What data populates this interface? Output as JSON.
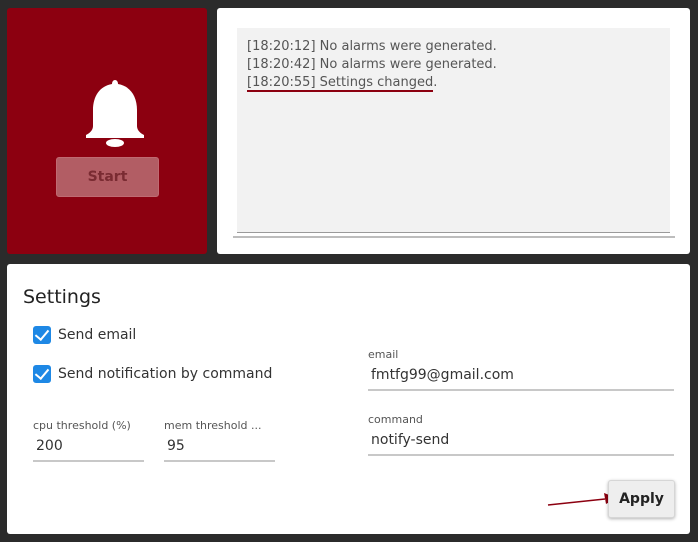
{
  "alarm": {
    "start_label": "Start",
    "bell_icon": "bell-icon",
    "panel_color": "#8c0010"
  },
  "log": {
    "lines": [
      "[18:20:12] No alarms were generated.",
      "[18:20:42] No alarms were generated."
    ],
    "last_line_highlighted": "[18:20:55] Settings changed",
    "last_line_suffix": "."
  },
  "settings": {
    "title": "Settings",
    "send_email_label": "Send email",
    "send_email_checked": true,
    "send_notification_label": "Send notification by command",
    "send_notification_checked": true,
    "cpu_threshold_label": "cpu threshold (%)",
    "cpu_threshold_value": "200",
    "mem_threshold_label": "mem threshold ...",
    "mem_threshold_value": "95",
    "email_label": "email",
    "email_value": "fmtfg99@gmail.com",
    "command_label": "command",
    "command_value": "notify-send",
    "apply_label": "Apply",
    "accent_color": "#1e88e5"
  }
}
